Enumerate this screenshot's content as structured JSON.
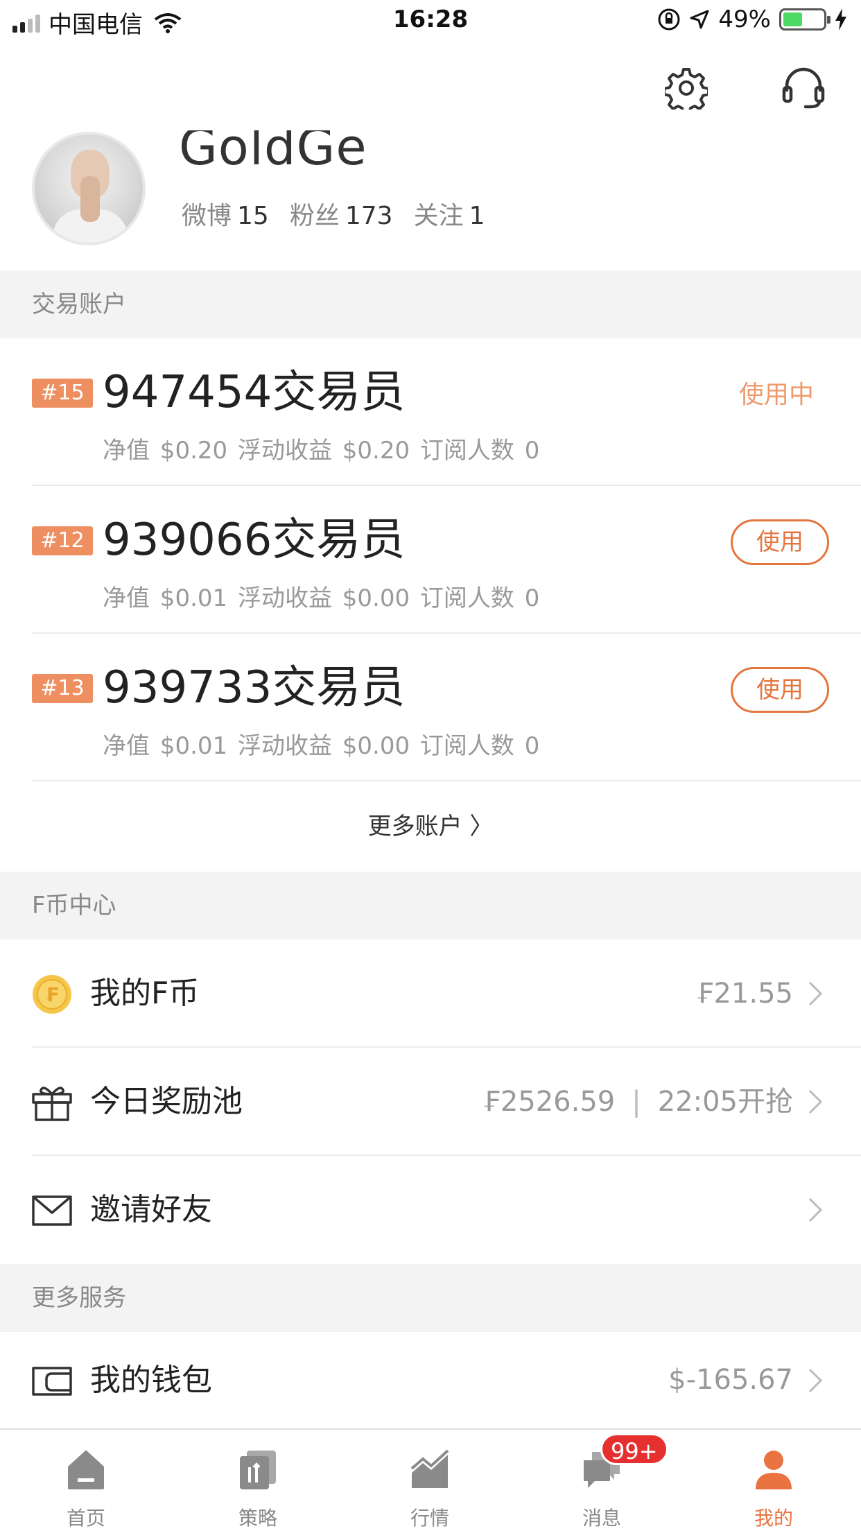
{
  "status_bar": {
    "carrier": "中国电信",
    "time": "16:28",
    "battery": "49%",
    "battery_level": 0.49
  },
  "header": {
    "icons": [
      "gear-icon",
      "headset-icon"
    ]
  },
  "profile": {
    "username": "GoldGe",
    "stats": [
      {
        "label": "微博",
        "value": "15"
      },
      {
        "label": "粉丝",
        "value": "173"
      },
      {
        "label": "关注",
        "value": "1"
      }
    ]
  },
  "trading_section": {
    "title": "交易账户",
    "accounts": [
      {
        "badge": "#15",
        "title": "947454交易员",
        "detail": "净值 $0.20  浮动收益 $0.20  订阅人数 0",
        "status": "使用中"
      },
      {
        "badge": "#12",
        "title": "939066交易员",
        "detail": "净值 $0.01  浮动收益 $0.00  订阅人数 0",
        "button": "使用"
      },
      {
        "badge": "#13",
        "title": "939733交易员",
        "detail": "净值 $0.01  浮动收益 $0.00  订阅人数 0",
        "button": "使用"
      }
    ],
    "more": "更多账户 〉"
  },
  "fcoin_section": {
    "title": "F币中心",
    "rows": [
      {
        "label": "我的F币",
        "value": "₣21.55"
      },
      {
        "label": "今日奖励池",
        "value": "₣2526.59",
        "extra": "22:05开抢"
      },
      {
        "label": "邀请好友"
      }
    ]
  },
  "services_section": {
    "title": "更多服务",
    "rows": [
      {
        "label": "我的钱包",
        "value": "$-165.67"
      }
    ]
  },
  "tabbar": {
    "tabs": [
      {
        "label": "首页",
        "icon": "home-icon"
      },
      {
        "label": "策略",
        "icon": "strategy-icon"
      },
      {
        "label": "行情",
        "icon": "market-chart-icon"
      },
      {
        "label": "消息",
        "icon": "message-icon"
      },
      {
        "label": "我的",
        "icon": "profile-icon",
        "active": true
      }
    ],
    "message_badge": "99+"
  },
  "colors": {
    "accent": "#e3763f",
    "badge": "#ee8f62",
    "notification": "#e63030"
  }
}
